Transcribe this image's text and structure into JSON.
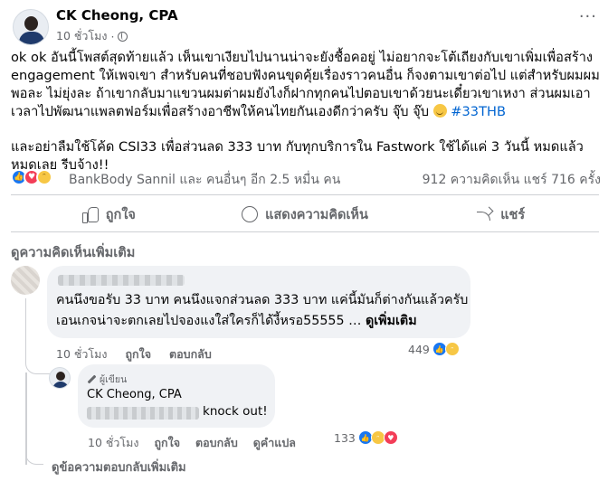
{
  "post": {
    "author": "CK Cheong, CPA",
    "time": "10 ชั่วโมง",
    "paragraph1": "ok ok อันนี้โพสต์สุดท้ายแล้ว เห็นเขาเงียบไปนานน่าจะยังชื้อคอยู่ ไม่อยากจะโต้เถียงกับเขาเพิ่มเพื่อสร้าง engagement ให้เพจเขา สำหรับคนที่ชอบฟังคนขุดคุ้ยเรื่องราวคนอื่น ก็จงตามเขาต่อไป แต่สำหรับผมผมพอละ ไม่ยุ่งละ ถ้าเขากลับมาแขวนผมต่าผมยังไงก็ฝากทุกคนไปตอบเขาด้วยนะเดี๋ยวเขาเหงา ส่วนผมเอาเวลาไปพัฒนาแพลตฟอร์มเพื่อสร้างอาชีพให้คนไทยกันเองดีกว่าครับ จุ๊บ จุ๊บ",
    "hashtag": "#33THB",
    "paragraph2": "และอย่าลืมใช้โค้ด CSI33 เพื่อส่วนลด 333 บาท กับทุกบริการใน Fastwork ใช้ได้แค่ 3 วันนี้ หมดแล้วหมดเลย รีบจ้าง!!"
  },
  "stats": {
    "reaction_names": "BankBody Sannil และ คนอื่นๆ อีก 2.5 หมื่น คน",
    "comments_shares": "912 ความคิดเห็น  แชร์ 716 ครั้ง"
  },
  "actions": {
    "like": "ถูกใจ",
    "comment": "แสดงความคิดเห็น",
    "share": "แชร์"
  },
  "more_comments": "ดูความคิดเห็นเพิ่มเติม",
  "comment1": {
    "text": "คนนึงขอรับ 33 บาท คนนึงแจกส่วนลด 333 บาท แค่นี้มันก็ต่างกันแล้วครับ เอนเกจน่าจะตกเลยไปจองแงใส่ใครก็ได้งี้หรอ55555 …",
    "see_more": "ดูเพิ่มเติม",
    "time": "10 ชั่วโมง",
    "like": "ถูกใจ",
    "reply": "ตอบกลับ",
    "reaction_count": "449"
  },
  "reply1": {
    "badge": "ผู้เขียน",
    "author": "CK Cheong, CPA",
    "text": "knock out!",
    "time": "10 ชั่วโมง",
    "like": "ถูกใจ",
    "reply": "ตอบกลับ",
    "translate": "ดูคำแปล",
    "reaction_count": "133"
  },
  "more_replies": "ดูข้อความตอบกลับเพิ่มเติม",
  "colors": {
    "accent": "#1877f2",
    "love": "#f33e58",
    "haha": "#f7c745",
    "secondary_text": "#65676b",
    "bubble": "#f0f2f5"
  }
}
